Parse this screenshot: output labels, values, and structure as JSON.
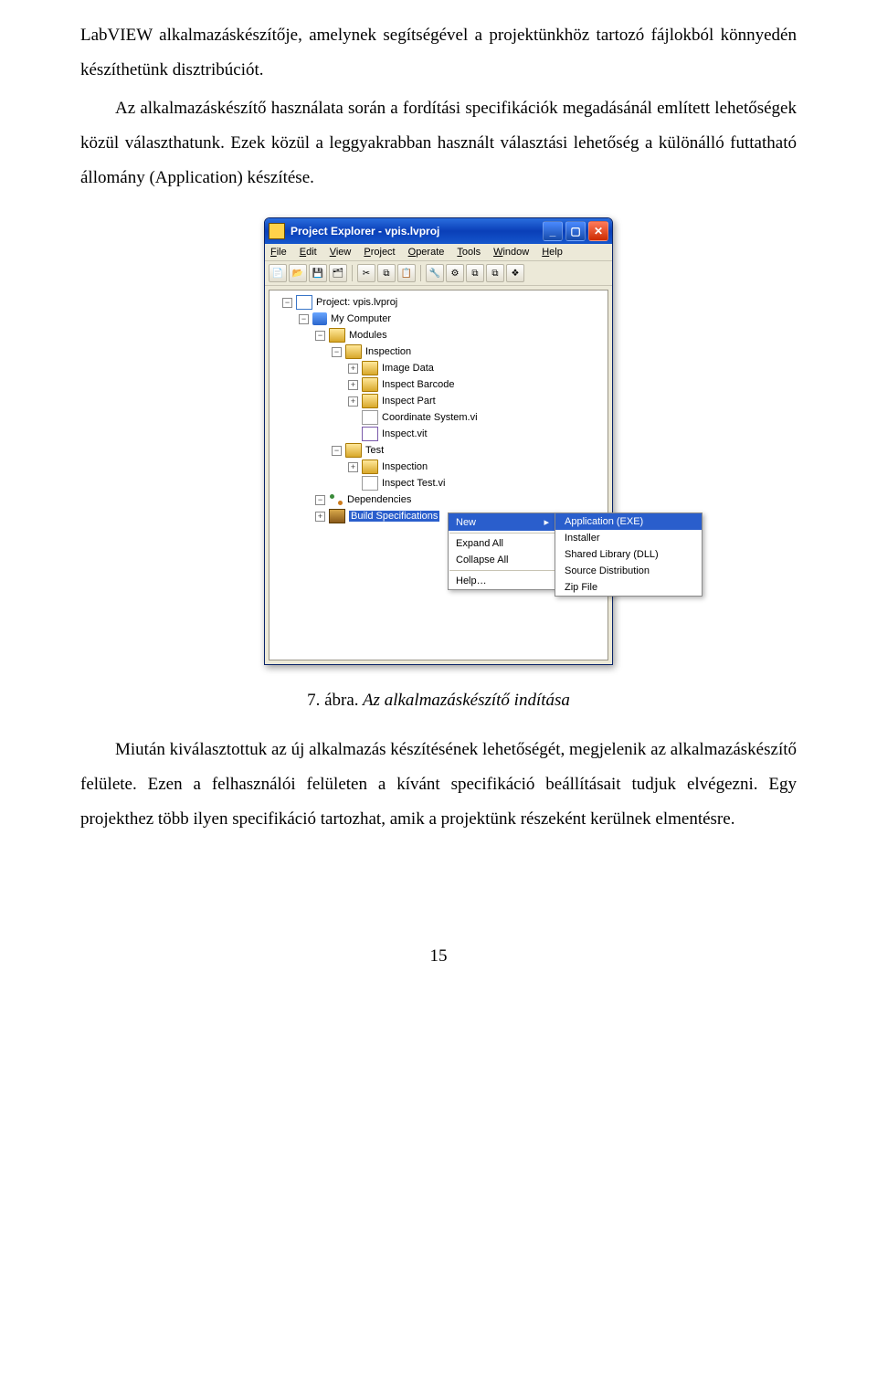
{
  "para1": "LabVIEW alkalmazáskészítője, amelynek segítségével a projektünkhöz tartozó fájlokból könnyedén készíthetünk disztribúciót.",
  "para2": "Az alkalmazáskészítő használata során a fordítási specifikációk megadásánál említett lehetőségek közül választhatunk. Ezek közül a leggyakrabban használt választási lehetőség a különálló futtatható állomány (Application) készítése.",
  "window": {
    "title": "Project Explorer - vpis.lvproj",
    "menu": {
      "file": "File",
      "edit": "Edit",
      "view": "View",
      "project": "Project",
      "operate": "Operate",
      "tools": "Tools",
      "window": "Window",
      "help": "Help"
    }
  },
  "tree": {
    "project": "Project: vpis.lvproj",
    "mycomputer": "My Computer",
    "modules": "Modules",
    "inspection": "Inspection",
    "imagedata": "Image Data",
    "inspbarcode": "Inspect Barcode",
    "insppart": "Inspect Part",
    "coordvi": "Coordinate System.vi",
    "inspectvit": "Inspect.vit",
    "test": "Test",
    "testinsp": "Inspection",
    "insptestvi": "Inspect Test.vi",
    "dependencies": "Dependencies",
    "buildspec": "Build Specifications"
  },
  "ctx": {
    "new": "New",
    "expand": "Expand All",
    "collapse": "Collapse All",
    "help": "Help…"
  },
  "sub": {
    "app": "Application (EXE)",
    "installer": "Installer",
    "dll": "Shared Library (DLL)",
    "srcdist": "Source Distribution",
    "zip": "Zip File"
  },
  "caption_num": "7. ábra.",
  "caption_text": " Az alkalmazáskészítő indítása",
  "para3": "Miután kiválasztottuk az új alkalmazás készítésének lehetőségét, megjelenik az alkalmazáskészítő felülete. Ezen a felhasználói felületen a kívánt specifikáció beállításait tudjuk elvégezni. Egy projekthez több ilyen specifikáció tartozhat, amik a projektünk részeként kerülnek elmentésre.",
  "pagenum": "15"
}
